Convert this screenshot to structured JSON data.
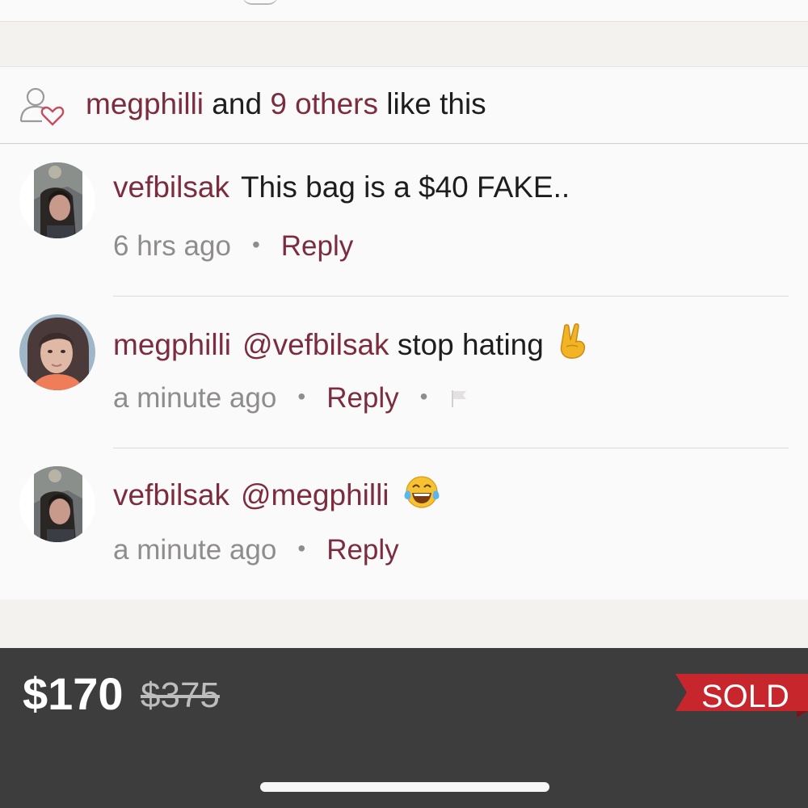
{
  "likes": {
    "user": "megphilli",
    "and_text": "and",
    "others": "9 others",
    "suffix": "like this"
  },
  "comments": [
    {
      "user": "vefbilsak",
      "mention": "",
      "text": "This bag is a $40 FAKE..",
      "emoji": "",
      "time": "6 hrs ago",
      "reply": "Reply",
      "has_flag": false
    },
    {
      "user": "megphilli",
      "mention": "@vefbilsak",
      "text": "stop hating",
      "emoji": "victory-hand",
      "time": "a minute ago",
      "reply": "Reply",
      "has_flag": true
    },
    {
      "user": "vefbilsak",
      "mention": "@megphilli",
      "text": "",
      "emoji": "tears-of-joy",
      "time": "a minute ago",
      "reply": "Reply",
      "has_flag": false
    }
  ],
  "footer": {
    "price": "$170",
    "original_price": "$375",
    "status": "SOLD"
  },
  "icons": [
    "like-heart-person-icon",
    "flag-icon",
    "victory-hand-emoji",
    "tears-of-joy-emoji"
  ],
  "colors": {
    "accent": "#7b2d3f",
    "sold_badge": "#c8262d",
    "footer_bg": "#3d3d3d"
  }
}
